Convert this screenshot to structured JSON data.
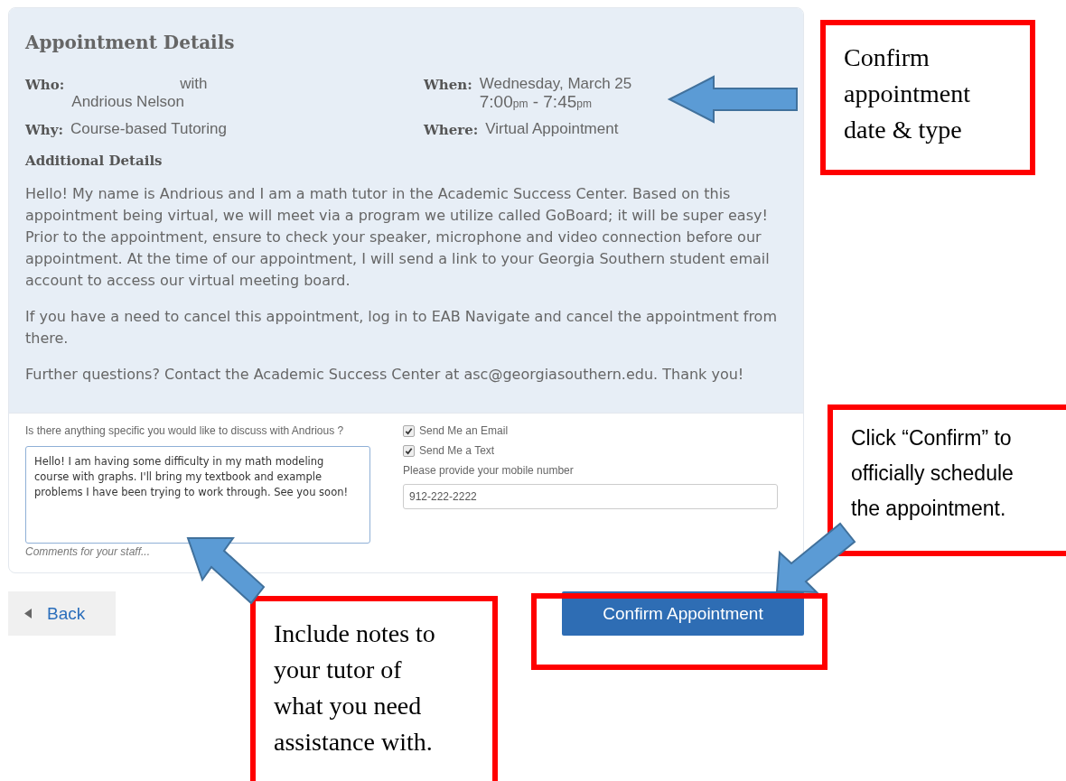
{
  "details": {
    "title": "Appointment Details",
    "who": {
      "label": "Who:",
      "with": "with",
      "name": "Andrious Nelson"
    },
    "why": {
      "label": "Why:",
      "value": "Course-based Tutoring"
    },
    "when": {
      "label": "When:",
      "date": "Wednesday, March 25",
      "time": "7:00$_{pm}$ - 7:45$_{pm}$"
    },
    "where": {
      "label": "Where:",
      "value": "Virtual Appointment"
    },
    "additional_title": "Additional Details",
    "paragraphs": [
      "Hello! My name is Andrious and I am a math tutor in the Academic Success Center. Based on this appointment being virtual, we will meet via a program we utilize called GoBoard; it will be super easy! Prior to the appointment, ensure to check your speaker, microphone and video connection before our appointment. At the time of our appointment, I will send a link to your Georgia Southern student email account to access our virtual meeting board.",
      "If you have a need to cancel this appointment, log in to EAB Navigate and cancel the appointment from there.",
      "Further questions? Contact the Academic Success Center at asc@georgiasouthern.edu. Thank you!"
    ]
  },
  "form": {
    "question": "Is there anything specific you would like to discuss with Andrious ?",
    "comments": {
      "value": "Hello! I am having some difficulty in my math modeling course with graphs. I'll bring my textbook and example problems I have been trying to work through. See you soon!",
      "hint": "Comments for your staff..."
    },
    "options": [
      {
        "label": "Send Me an Email",
        "checked": true
      },
      {
        "label": "Send Me a Text",
        "checked": true
      }
    ],
    "mobile": {
      "label": "Please provide your mobile number",
      "value": "912-222-2222"
    }
  },
  "buttons": {
    "back": "Back",
    "confirm": "Confirm Appointment"
  },
  "callouts": [
    {
      "text": "Confirm appointment date & type"
    },
    {
      "text": "Click “Confirm” to officially schedule the appointment."
    },
    {
      "text": "Include notes to your tutor of what you need assistance with."
    }
  ]
}
